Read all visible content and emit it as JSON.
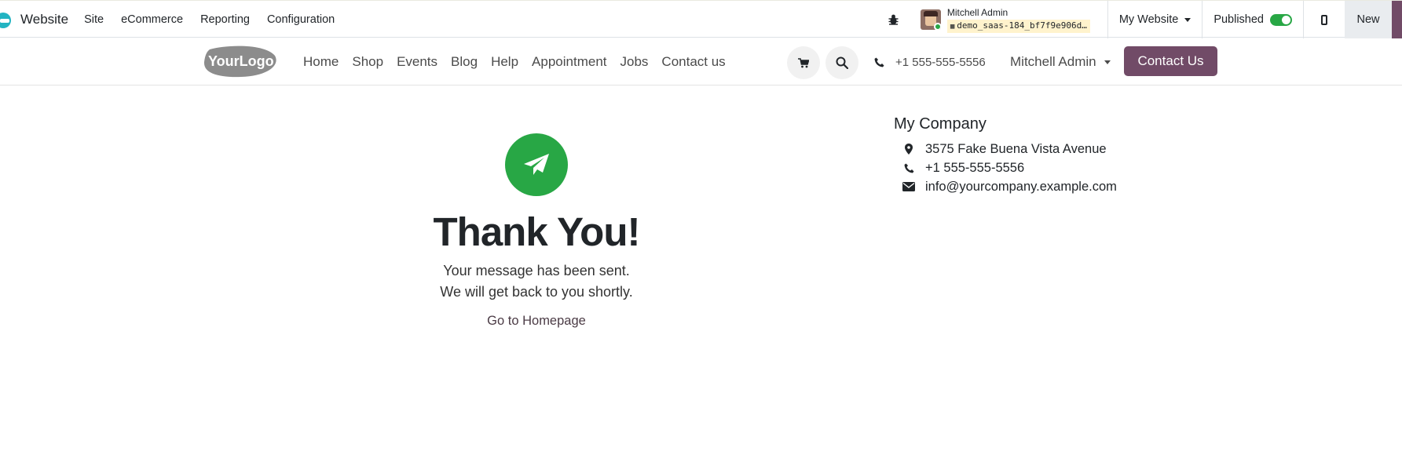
{
  "odoo_navbar": {
    "app_name": "Website",
    "menu": [
      "Site",
      "eCommerce",
      "Reporting",
      "Configuration"
    ],
    "user_name": "Mitchell Admin",
    "database": "demo_saas-184_bf7f9e906d…",
    "website_selector": "My Website",
    "published_label": "Published",
    "published": true,
    "new_label": "New"
  },
  "site_header": {
    "logo_text": "YourLogo",
    "nav_links": [
      "Home",
      "Shop",
      "Events",
      "Blog",
      "Help",
      "Appointment",
      "Jobs",
      "Contact us"
    ],
    "phone": "+1 555-555-5556",
    "user_name": "Mitchell Admin",
    "cta_label": "Contact Us"
  },
  "thank_you": {
    "title": "Thank You!",
    "line1": "Your message has been sent.",
    "line2": "We will get back to you shortly.",
    "home_link": "Go to Homepage"
  },
  "company": {
    "name": "My Company",
    "address": "3575 Fake Buena Vista Avenue",
    "phone": "+1 555-555-5556",
    "email": "info@yourcompany.example.com"
  },
  "colors": {
    "brand": "#714b67",
    "success": "#28a745",
    "db_badge": "#fff3cd"
  }
}
